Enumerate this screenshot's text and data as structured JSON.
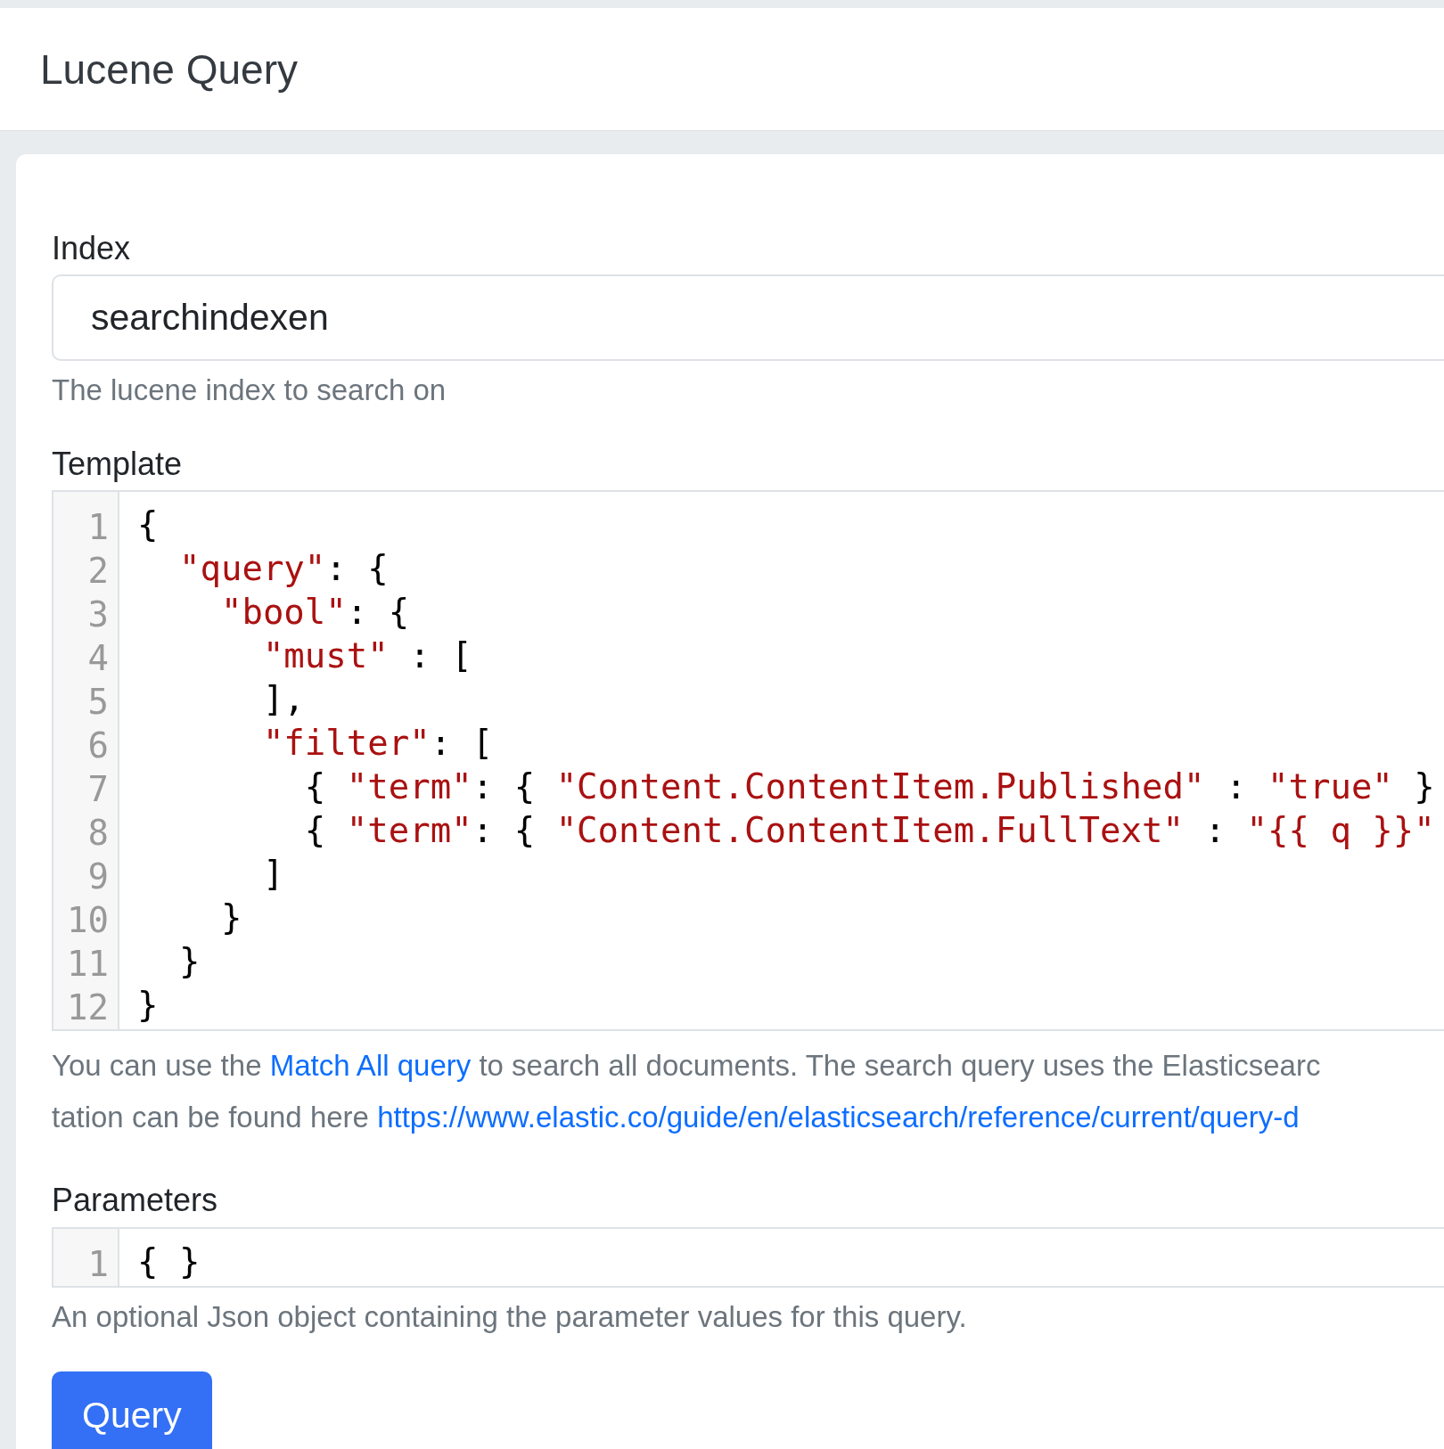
{
  "header": {
    "title": "Lucene Query"
  },
  "index_field": {
    "label": "Index",
    "value": "searchindexen",
    "hint": "The lucene index to search on"
  },
  "template": {
    "label": "Template",
    "lines": [
      {
        "number": "1",
        "tokens": [
          {
            "kind": "punct",
            "text": "{"
          }
        ]
      },
      {
        "number": "2",
        "tokens": [
          {
            "kind": "string",
            "text": "  \"query\""
          },
          {
            "kind": "punct",
            "text": ": {"
          }
        ]
      },
      {
        "number": "3",
        "tokens": [
          {
            "kind": "string",
            "text": "    \"bool\""
          },
          {
            "kind": "punct",
            "text": ": {"
          }
        ]
      },
      {
        "number": "4",
        "tokens": [
          {
            "kind": "string",
            "text": "      \"must\""
          },
          {
            "kind": "punct",
            "text": " : ["
          }
        ]
      },
      {
        "number": "5",
        "tokens": [
          {
            "kind": "punct",
            "text": "      ],"
          }
        ]
      },
      {
        "number": "6",
        "tokens": [
          {
            "kind": "string",
            "text": "      \"filter\""
          },
          {
            "kind": "punct",
            "text": ": ["
          }
        ]
      },
      {
        "number": "7",
        "tokens": [
          {
            "kind": "punct",
            "text": "        { "
          },
          {
            "kind": "string",
            "text": "\"term\""
          },
          {
            "kind": "punct",
            "text": ": { "
          },
          {
            "kind": "string",
            "text": "\"Content.ContentItem.Published\""
          },
          {
            "kind": "punct",
            "text": " : "
          },
          {
            "kind": "string",
            "text": "\"true\""
          },
          {
            "kind": "punct",
            "text": " }"
          }
        ]
      },
      {
        "number": "8",
        "tokens": [
          {
            "kind": "punct",
            "text": "        { "
          },
          {
            "kind": "string",
            "text": "\"term\""
          },
          {
            "kind": "punct",
            "text": ": { "
          },
          {
            "kind": "string",
            "text": "\"Content.ContentItem.FullText\""
          },
          {
            "kind": "punct",
            "text": " : "
          },
          {
            "kind": "string",
            "text": "\"{{ q }}\""
          }
        ]
      },
      {
        "number": "9",
        "tokens": [
          {
            "kind": "punct",
            "text": "      ]"
          }
        ]
      },
      {
        "number": "10",
        "tokens": [
          {
            "kind": "punct",
            "text": "    }"
          }
        ]
      },
      {
        "number": "11",
        "tokens": [
          {
            "kind": "punct",
            "text": "  }"
          }
        ]
      },
      {
        "number": "12",
        "tokens": [
          {
            "kind": "punct",
            "text": "}"
          }
        ]
      }
    ],
    "help_lines": [
      [
        {
          "kind": "text",
          "text": "You can use the "
        },
        {
          "kind": "link",
          "text": "Match All query"
        },
        {
          "kind": "text",
          "text": " to search all documents. The search query uses the Elasticsearc"
        }
      ],
      [
        {
          "kind": "text",
          "text": "tation can be found here "
        },
        {
          "kind": "link",
          "text": "https://www.elastic.co/guide/en/elasticsearch/reference/current/query-d"
        }
      ]
    ]
  },
  "parameters": {
    "label": "Parameters",
    "lines": [
      {
        "number": "1",
        "tokens": [
          {
            "kind": "punct",
            "text": "{ }"
          }
        ]
      }
    ],
    "hint": "An optional Json object containing the parameter values for this query."
  },
  "submit_button": {
    "label": "Query"
  }
}
